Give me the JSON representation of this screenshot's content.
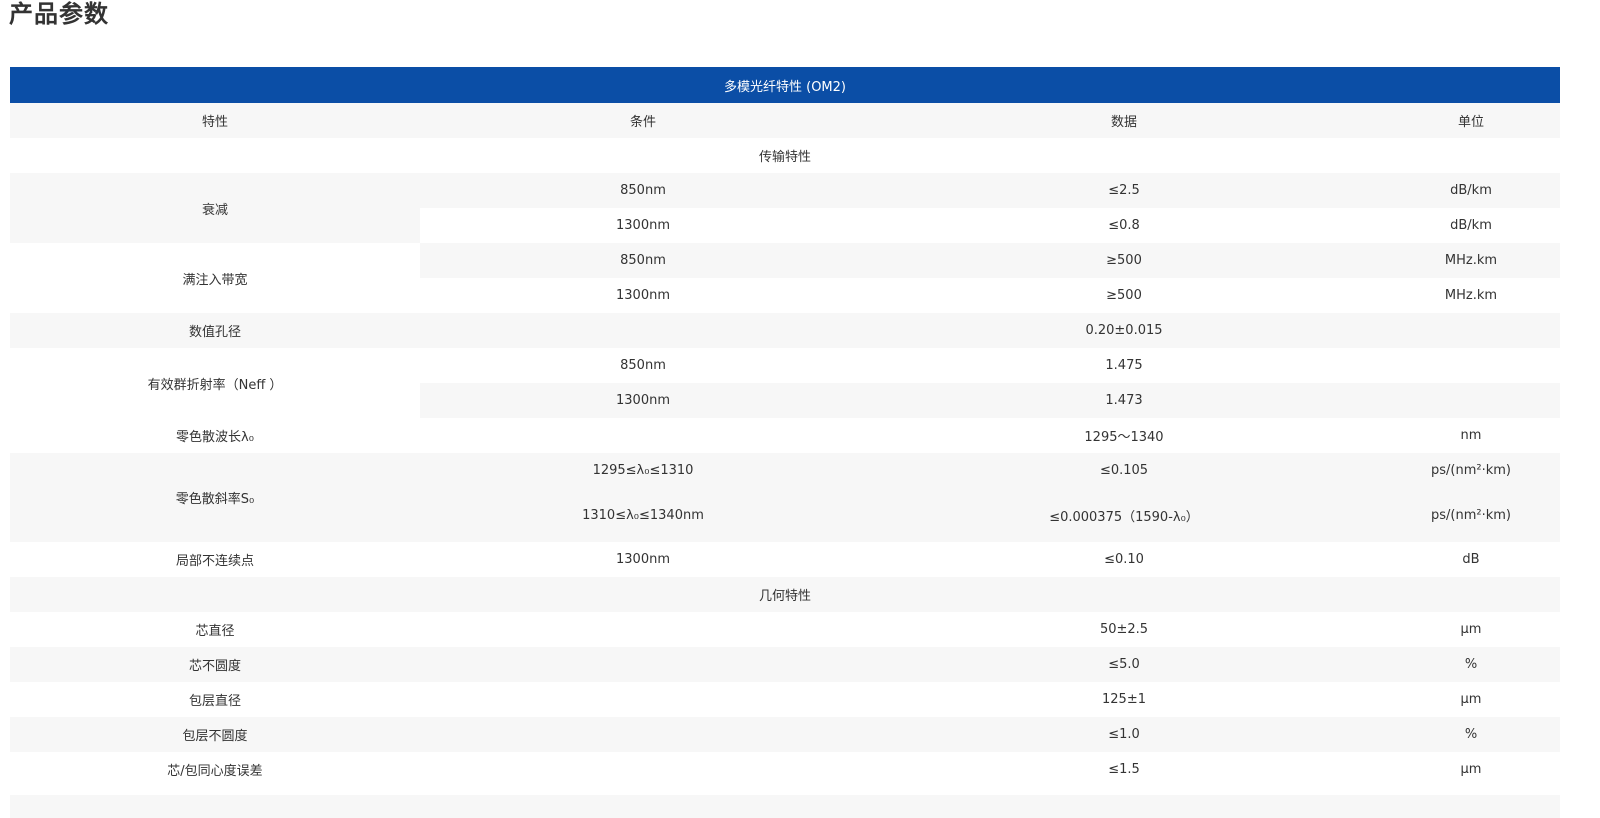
{
  "page_title": "产品参数",
  "table": {
    "title": "多模光纤特性 (OM2)",
    "headers": [
      "特性",
      "条件",
      "数据",
      "单位"
    ],
    "sections": {
      "transmission": "传输特性",
      "geometry": "几何特性"
    },
    "attenuation": {
      "name": "衰减",
      "rows": [
        {
          "condition": "850nm",
          "value": "≤2.5",
          "unit": "dB/km"
        },
        {
          "condition": "1300nm",
          "value": "≤0.8",
          "unit": "dB/km"
        }
      ]
    },
    "bandwidth": {
      "name": "满注入带宽",
      "rows": [
        {
          "condition": "850nm",
          "value": "≥500",
          "unit": "MHz.km"
        },
        {
          "condition": "1300nm",
          "value": "≥500",
          "unit": "MHz.km"
        }
      ]
    },
    "numerical_aperture": {
      "name": "数值孔径",
      "value": "0.20±0.015"
    },
    "group_index": {
      "name": "有效群折射率（Neff ）",
      "rows": [
        {
          "condition": "850nm",
          "value": "1.475"
        },
        {
          "condition": "1300nm",
          "value": "1.473"
        }
      ]
    },
    "zero_dispersion_wavelength": {
      "name": "零色散波长λ₀",
      "value": "1295～1340",
      "unit": "nm"
    },
    "zero_dispersion_slope": {
      "name": "零色散斜率S₀",
      "rows": [
        {
          "condition": "1295≤λ₀≤1310",
          "value": "≤0.105",
          "unit": "ps/(nm²·km)"
        },
        {
          "condition": "1310≤λ₀≤1340nm",
          "value": "≤0.000375（1590-λ₀）",
          "unit": "ps/(nm²·km)"
        }
      ]
    },
    "point_discontinuity": {
      "name": "局部不连续点",
      "condition": "1300nm",
      "value": "≤0.10",
      "unit": "dB"
    },
    "core_diameter": {
      "name": "芯直径",
      "value": "50±2.5",
      "unit": "μm"
    },
    "core_noncircularity": {
      "name": "芯不圆度",
      "value": "≤5.0",
      "unit": "%"
    },
    "cladding_diameter": {
      "name": "包层直径",
      "value": "125±1",
      "unit": "μm"
    },
    "cladding_noncircularity": {
      "name": "包层不圆度",
      "value": "≤1.0",
      "unit": "%"
    },
    "concentricity_error": {
      "name": "芯/包同心度误差",
      "value": "≤1.5",
      "unit": "μm"
    }
  }
}
